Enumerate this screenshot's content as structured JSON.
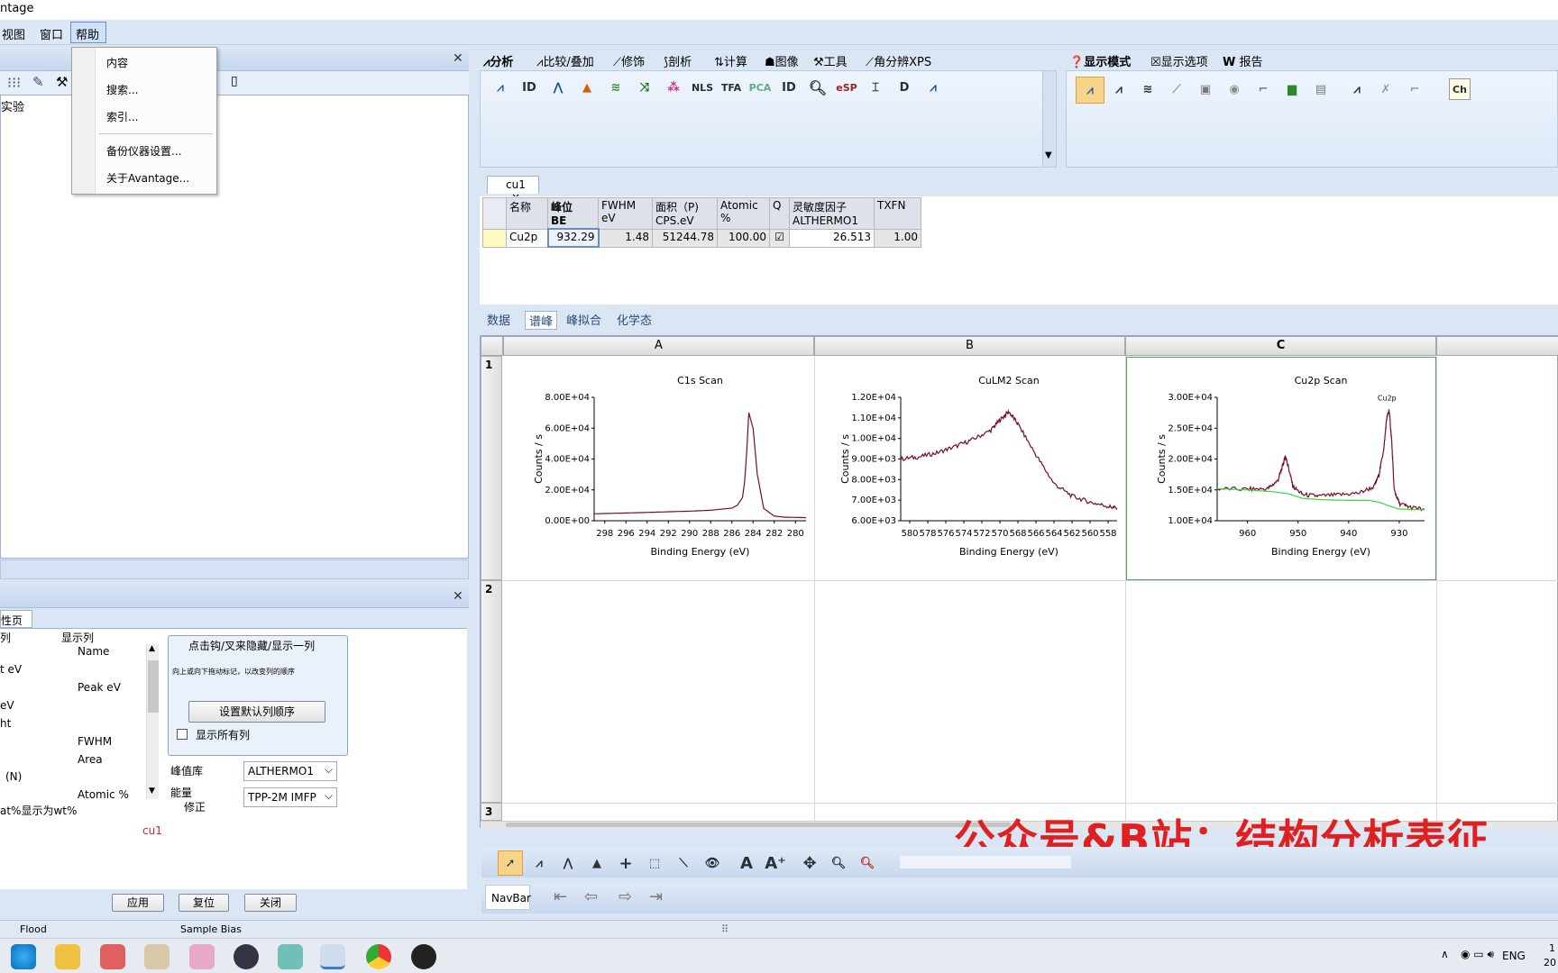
{
  "window": {
    "title_fragment": "ntage"
  },
  "menu": {
    "items": [
      "视图",
      "窗口",
      "帮助"
    ]
  },
  "help_menu": {
    "items": [
      "内容",
      "搜索...",
      "索引...",
      "备份仪器设置...",
      "关于Avantage..."
    ]
  },
  "tree": {
    "item": "实验"
  },
  "ribbon": {
    "tabs": [
      "分析",
      "比较/叠加",
      "修饰",
      "剖析",
      "计算",
      "图像",
      "工具",
      "角分辨XPS"
    ],
    "right_tabs": [
      "显示模式",
      "显示选项",
      "报告"
    ],
    "icon_labels": [
      "ID",
      "NLS",
      "TFA",
      "PCA",
      "ID",
      "eSP",
      "D"
    ],
    "right_icon_label": "Ch"
  },
  "doc_tab": {
    "label": "cu1",
    "close": "×"
  },
  "peak_table": {
    "headers": [
      [
        "名称",
        ""
      ],
      [
        "峰位",
        "BE"
      ],
      [
        "FWHM",
        "eV"
      ],
      [
        "面积（P)",
        "CPS.eV"
      ],
      [
        "Atomic",
        "%"
      ],
      [
        "Q",
        ""
      ],
      [
        "灵敏度因子",
        "ALTHERMO1"
      ],
      [
        "TXFN",
        ""
      ]
    ],
    "row": [
      "Cu2p",
      "932.29",
      "1.48",
      "51244.78",
      "100.00",
      "☑",
      "26.513",
      "1.00"
    ]
  },
  "sub_tabs": [
    "数据",
    "谱峰",
    "峰拟合",
    "化学态"
  ],
  "sheet": {
    "columns": [
      "A",
      "B",
      "C"
    ],
    "rows": [
      "1",
      "2",
      "3"
    ]
  },
  "chart_data": [
    {
      "type": "line",
      "title": "C1s Scan",
      "xlabel": "Binding Energy (eV)",
      "ylabel": "Counts / s",
      "xlim": [
        299,
        279
      ],
      "ylim": [
        0,
        80000
      ],
      "xticks": [
        "298",
        "296",
        "294",
        "292",
        "290",
        "288",
        "286",
        "284",
        "282",
        "280"
      ],
      "yticks": [
        "0.00E+00",
        "2.00E+04",
        "4.00E+04",
        "6.00E+04",
        "8.00E+04"
      ],
      "series": [
        {
          "x": [
            299,
            296,
            293,
            290,
            288,
            286,
            285.5,
            285,
            284.8,
            284.6,
            284.4,
            284,
            283.6,
            283,
            282,
            281,
            279
          ],
          "y": [
            4500,
            5000,
            5600,
            6200,
            6800,
            8200,
            10000,
            15000,
            25000,
            45000,
            70000,
            60000,
            30000,
            8000,
            3000,
            2300,
            2000
          ]
        }
      ]
    },
    {
      "type": "line",
      "title": "CuLM2 Scan",
      "xlabel": "Binding Energy (eV)",
      "ylabel": "Counts / s",
      "xlim": [
        581,
        557
      ],
      "ylim": [
        6000,
        12000
      ],
      "xticks": [
        "580",
        "578",
        "576",
        "574",
        "572",
        "570",
        "568",
        "566",
        "564",
        "562",
        "560",
        "558"
      ],
      "yticks": [
        "6.00E+03",
        "7.00E+03",
        "8.00E+03",
        "9.00E+03",
        "1.00E+04",
        "1.10E+04",
        "1.20E+04"
      ],
      "series": [
        {
          "x": [
            581,
            579,
            577,
            575,
            573,
            571,
            570,
            569,
            568,
            566,
            564,
            562,
            560,
            558,
            557
          ],
          "y": [
            9000,
            9100,
            9300,
            9600,
            9950,
            10400,
            10900,
            11300,
            10700,
            9200,
            7800,
            7200,
            6900,
            6700,
            6600
          ]
        }
      ]
    },
    {
      "type": "line",
      "title": "Cu2p Scan",
      "xlabel": "Binding Energy (eV)",
      "ylabel": "Counts / s",
      "annotation": "Cu2p",
      "xlim": [
        966,
        925
      ],
      "ylim": [
        10000,
        30000
      ],
      "xticks": [
        "960",
        "950",
        "940",
        "930"
      ],
      "yticks": [
        "1.00E+04",
        "1.50E+04",
        "2.00E+04",
        "2.50E+04",
        "3.00E+04"
      ],
      "series": [
        {
          "x": [
            966,
            960,
            956,
            954,
            953,
            952.5,
            952,
            951,
            949,
            946,
            942,
            938,
            935,
            934,
            933,
            932.5,
            932,
            931.5,
            931,
            930,
            928,
            925
          ],
          "y": [
            15200,
            15100,
            15200,
            16500,
            19000,
            20500,
            19000,
            15500,
            14200,
            14000,
            14200,
            14500,
            15500,
            17500,
            22000,
            26500,
            28000,
            23000,
            15000,
            12800,
            12200,
            11800
          ]
        },
        {
          "x": [
            966,
            960,
            955,
            952,
            949,
            945,
            940,
            936,
            934,
            932,
            930,
            927,
            925
          ],
          "y": [
            15200,
            15000,
            14700,
            14400,
            13600,
            13400,
            13300,
            13300,
            13000,
            12400,
            11900,
            11800,
            11800
          ]
        }
      ]
    }
  ],
  "props": {
    "tab": "性页",
    "list_header_left": "列",
    "list_header_right": "显示列",
    "left_items": [
      "t eV",
      "eV",
      "ht",
      "(N)"
    ],
    "right_items": [
      "Name",
      "Peak eV",
      "FWHM",
      "Area",
      "Atomic %"
    ],
    "hint_title": "点击钩/叉来隐藏/显示一列",
    "hint_text": "向上或向下拖动标记，以改变列的顺序",
    "set_default_btn": "设置默认列顺序",
    "show_all_label": "显示所有列",
    "library_label": "峰值库",
    "library_value": "ALTHERMO1",
    "energy_label": "能量",
    "correction_label": "修正",
    "energy_value": "TPP-2M IMFP",
    "at_wt_label": "at%显示为wt%",
    "dataset": "cu1",
    "buttons": [
      "应用",
      "复位",
      "关闭"
    ]
  },
  "navbar": {
    "label": "NavBar"
  },
  "status": {
    "flood": "Flood",
    "bias": "Sample Bias"
  },
  "tray": {
    "lang": "ENG",
    "time": "1",
    "date": "20"
  },
  "watermark": "公众号&B站：结构分析表征",
  "colors": {
    "curve": "#7a0c28",
    "background_fit": "#3cd23c",
    "menu_bg": "#dde8f6",
    "watermark": "#e02020"
  }
}
